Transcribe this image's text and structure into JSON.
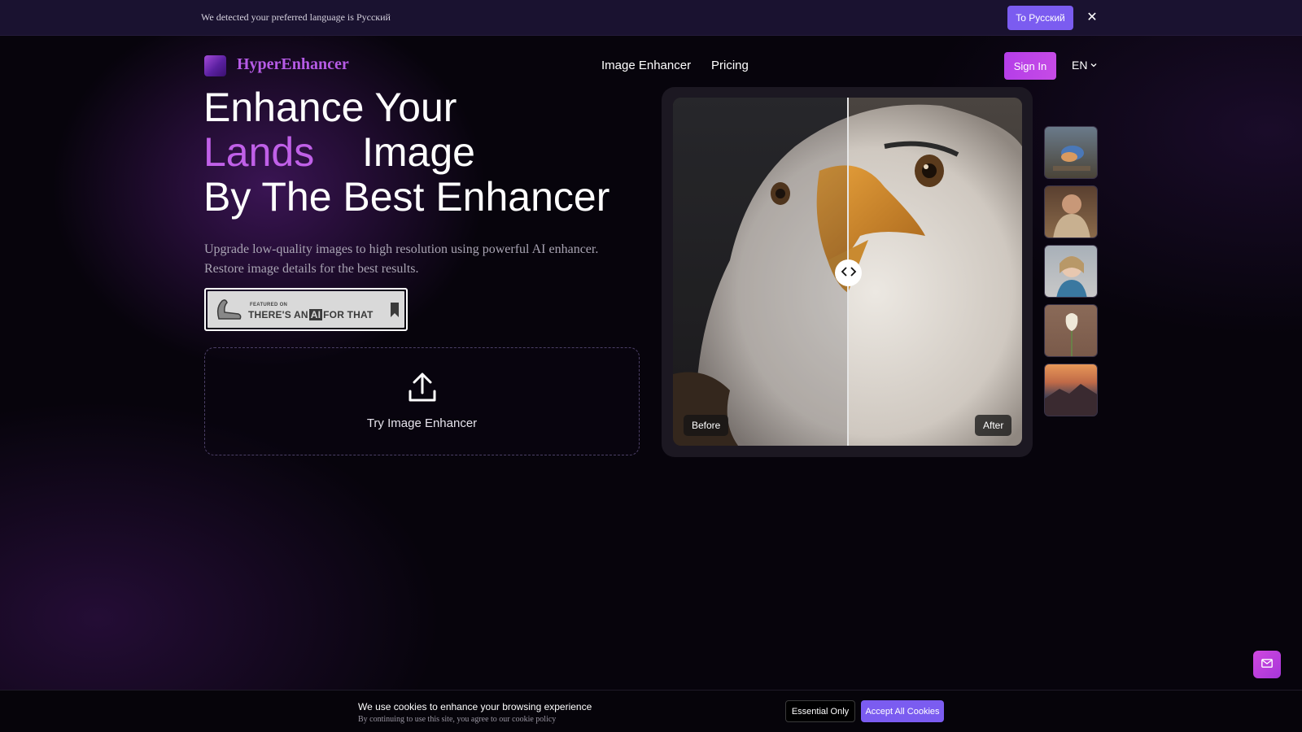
{
  "banner": {
    "text": "We detected your preferred language is Русский",
    "switch_label": "To Русский",
    "close_glyph": "✕"
  },
  "nav": {
    "brand": "HyperEnhancer",
    "links": [
      "Image Enhancer",
      "Pricing"
    ],
    "signin_label": "Sign In",
    "language": "EN"
  },
  "hero": {
    "title_line1": "Enhance Your",
    "title_accent": "Lands",
    "title_line2_rest": "Image",
    "title_line3": "By The Best Enhancer",
    "subtitle": "Upgrade low-quality images to high resolution using powerful AI enhancer. Restore image details for the best results.",
    "badge_small": "FEATURED ON",
    "badge_big_a": "THERE'S AN",
    "badge_big_ai": "AI",
    "badge_big_b": "FOR THAT",
    "upload_label": "Try Image Enhancer"
  },
  "compare": {
    "before_label": "Before",
    "after_label": "After",
    "thumbnails": [
      "bird",
      "fur-coat-portrait",
      "woman-portrait",
      "tulip",
      "mountain-sunset"
    ]
  },
  "cookie": {
    "title": "We use cookies to enhance your browsing experience",
    "subtitle": "By continuing to use this site, you agree to our cookie policy",
    "essential_label": "Essential Only",
    "accept_label": "Accept All Cookies"
  },
  "colors": {
    "accent": "#c060e8",
    "button_violet": "#7b5cf0",
    "signin_magenta": "#b53ee8"
  },
  "icons": [
    "close-icon",
    "chevron-down-icon",
    "upload-icon",
    "chevron-left-icon",
    "chevron-right-icon",
    "mail-icon"
  ]
}
